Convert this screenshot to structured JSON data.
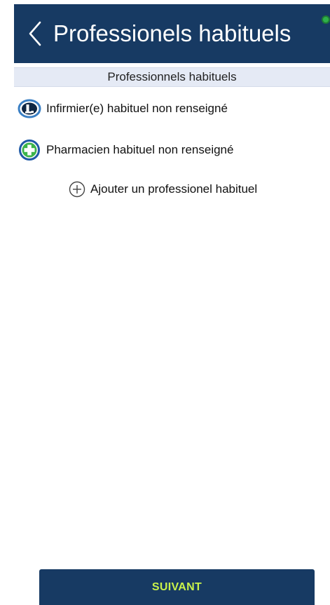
{
  "header": {
    "back_icon": "chevron-left-icon",
    "title": "Professionels habituels",
    "status_color": "#2fb14a"
  },
  "section": {
    "title": "Professionnels habituels"
  },
  "professionals": [
    {
      "icon": "nurse-icon",
      "label": "Infirmier(e) habituel non renseigné"
    },
    {
      "icon": "pharmacy-cross-icon",
      "label": "Pharmacien habituel non renseigné"
    }
  ],
  "add": {
    "icon": "plus-circle-icon",
    "label": "Ajouter un professionel habituel"
  },
  "footer": {
    "next_label": "SUIVANT"
  },
  "colors": {
    "primary": "#173a63",
    "accent_text": "#c9f24a",
    "section_bg": "#e5eaf5"
  }
}
